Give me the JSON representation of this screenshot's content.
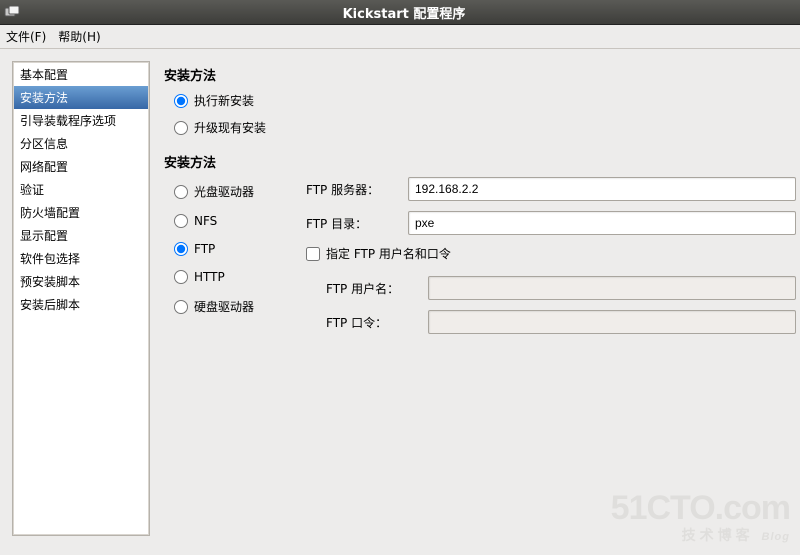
{
  "window": {
    "title": "Kickstart 配置程序"
  },
  "menubar": {
    "file": "文件(F)",
    "help": "帮助(H)"
  },
  "sidebar": {
    "items": [
      {
        "label": "基本配置"
      },
      {
        "label": "安装方法"
      },
      {
        "label": "引导装载程序选项"
      },
      {
        "label": "分区信息"
      },
      {
        "label": "网络配置"
      },
      {
        "label": "验证"
      },
      {
        "label": "防火墙配置"
      },
      {
        "label": "显示配置"
      },
      {
        "label": "软件包选择"
      },
      {
        "label": "预安装脚本"
      },
      {
        "label": "安装后脚本"
      }
    ],
    "selected_index": 1
  },
  "section1": {
    "title": "安装方法",
    "options": {
      "fresh": {
        "label": "执行新安装",
        "checked": true
      },
      "upgrade": {
        "label": "升级现有安装",
        "checked": false
      }
    }
  },
  "section2": {
    "title": "安装方法",
    "methods": {
      "cdrom": {
        "label": "光盘驱动器",
        "checked": false
      },
      "nfs": {
        "label": "NFS",
        "checked": false
      },
      "ftp": {
        "label": "FTP",
        "checked": true
      },
      "http": {
        "label": "HTTP",
        "checked": false
      },
      "hdd": {
        "label": "硬盘驱动器",
        "checked": false
      }
    },
    "ftp": {
      "server_label": "FTP 服务器：",
      "server_value": "192.168.2.2",
      "dir_label": "FTP 目录：",
      "dir_value": "pxe",
      "auth_checkbox_label": "指定 FTP 用户名和口令",
      "auth_checked": false,
      "user_label": "FTP 用户名：",
      "user_value": "",
      "pass_label": "FTP 口令：",
      "pass_value": ""
    }
  },
  "watermark": {
    "line1": "51CTO.com",
    "line2": "技术博客",
    "line2_suffix": "Blog"
  }
}
